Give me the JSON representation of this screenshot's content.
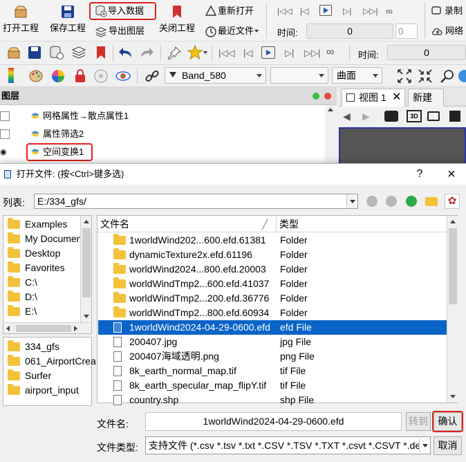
{
  "ribbon": {
    "open_project": "打开工程",
    "save_project": "保存工程",
    "import_data": "导入数据",
    "export_layer": "导出图层",
    "close_project": "关闭工程",
    "reopen": "重新打开",
    "recent_files": "最近文件",
    "time_label": "时间:",
    "time_value": "0",
    "spin_value": "0",
    "record": "录制",
    "network": "网络"
  },
  "toolbar2": {
    "time_label": "时间:",
    "time_value": "0"
  },
  "toolbar3": {
    "band": "Band_580",
    "surface": "曲面"
  },
  "layer_panel": {
    "title": "图层",
    "layers": [
      {
        "name": "网格属性→散点属性1"
      },
      {
        "name": "属性筛选2"
      },
      {
        "name": "空间变换1"
      }
    ]
  },
  "view_panel": {
    "tab_view": "视图 1",
    "tab_new": "新建"
  },
  "dialog": {
    "title": "打开文件: (按<Ctrl>键多选)",
    "help": "?",
    "close": "×",
    "list_label": "列表:",
    "path": "E:/334_gfs/",
    "drives": [
      {
        "name": "Examples"
      },
      {
        "name": "My Documen"
      },
      {
        "name": "Desktop"
      },
      {
        "name": "Favorites"
      },
      {
        "name": "C:\\"
      },
      {
        "name": "D:\\"
      },
      {
        "name": "E:\\"
      }
    ],
    "recent": [
      {
        "name": "334_gfs"
      },
      {
        "name": "061_AirportCrea"
      },
      {
        "name": "Surfer"
      },
      {
        "name": "airport_input"
      }
    ],
    "col_name": "文件名",
    "col_type": "类型",
    "files": [
      {
        "name": "1worldWind202...600.efd.61381",
        "type": "Folder",
        "kind": "folder"
      },
      {
        "name": "dynamicTexture2x.efd.61196",
        "type": "Folder",
        "kind": "folder"
      },
      {
        "name": "worldWind2024...800.efd.20003",
        "type": "Folder",
        "kind": "folder"
      },
      {
        "name": "worldWindTmp2...600.efd.41037",
        "type": "Folder",
        "kind": "folder"
      },
      {
        "name": "worldWindTmp2...200.efd.36776",
        "type": "Folder",
        "kind": "folder"
      },
      {
        "name": "worldWindTmp2...800.efd.60934",
        "type": "Folder",
        "kind": "folder"
      },
      {
        "name": "1worldWind2024-04-29-0600.efd",
        "type": "efd File",
        "kind": "file",
        "selected": true
      },
      {
        "name": "200407.jpg",
        "type": "jpg File",
        "kind": "file"
      },
      {
        "name": "200407海域透明.png",
        "type": "png File",
        "kind": "file"
      },
      {
        "name": "8k_earth_normal_map.tif",
        "type": "tif File",
        "kind": "file"
      },
      {
        "name": "8k_earth_specular_map_flipY.tif",
        "type": "tif File",
        "kind": "file"
      },
      {
        "name": "country.shp",
        "type": "shp File",
        "kind": "file"
      }
    ],
    "filename_label": "文件名:",
    "filename_value": "1worldWind2024-04-29-0600.efd",
    "goto_button": "转到",
    "confirm_button": "确认",
    "filetype_label": "文件类型:",
    "filetype_value": "支持文件 (*.csv *.tsv *.txt *.CSV *.TSV *.TXT *.csvt *.CSVT *.dem",
    "cancel_button": "取消"
  },
  "colors": {
    "accent_red": "#e0211b",
    "selection_blue": "#0a64c8",
    "folder_yellow": "#f3c23b"
  }
}
